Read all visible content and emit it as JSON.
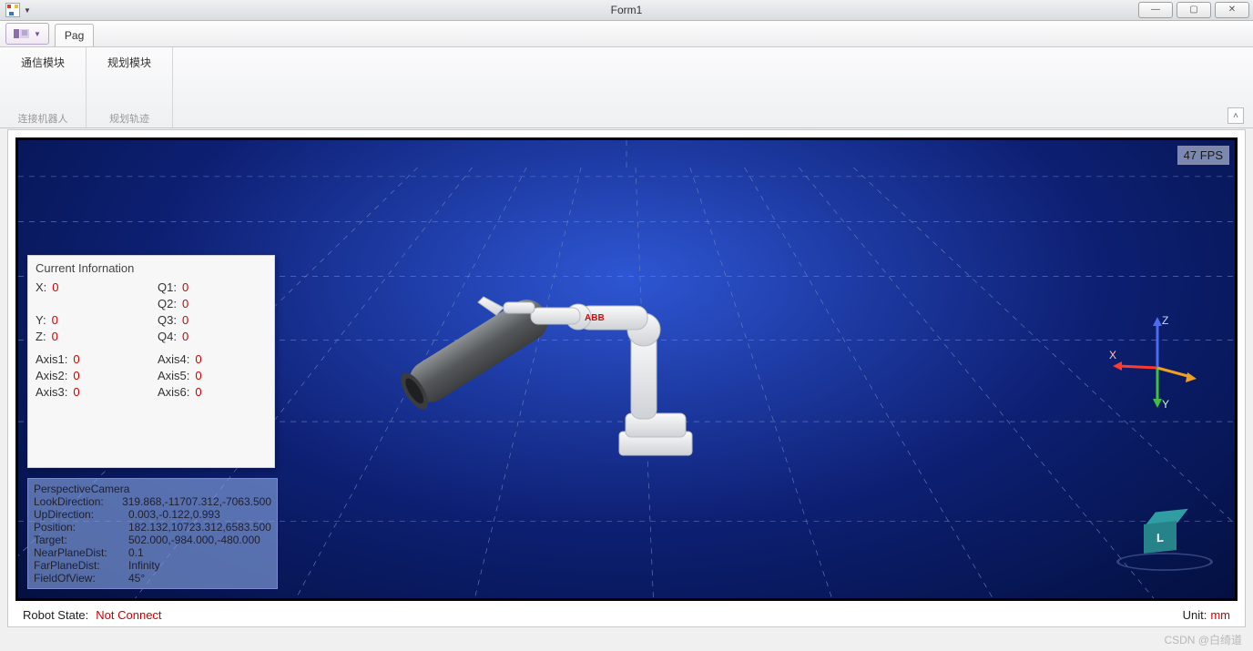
{
  "window": {
    "title": "Form1"
  },
  "ribbon": {
    "tab1": "Pag",
    "group1": {
      "button": "通信模块",
      "caption": "连接机器人"
    },
    "group2": {
      "button": "规划模块",
      "caption": "规划轨迹"
    }
  },
  "viewport": {
    "fps": "47 FPS",
    "axis_x": "X",
    "axis_y": "Y",
    "axis_z": "Z",
    "cube_face": "L"
  },
  "info": {
    "title": "Current Infornation",
    "X_label": "X:",
    "X": "0",
    "Y_label": "Y:",
    "Y": "0",
    "Z_label": "Z:",
    "Z": "0",
    "Q1_label": "Q1:",
    "Q1": "0",
    "Q2_label": "Q2:",
    "Q2": "0",
    "Q3_label": "Q3:",
    "Q3": "0",
    "Q4_label": "Q4:",
    "Q4": "0",
    "A1_label": "Axis1:",
    "A1": "0",
    "A2_label": "Axis2:",
    "A2": "0",
    "A3_label": "Axis3:",
    "A3": "0",
    "A4_label": "Axis4:",
    "A4": "0",
    "A5_label": "Axis5:",
    "A5": "0",
    "A6_label": "Axis6:",
    "A6": "0"
  },
  "camera": {
    "title": "PerspectiveCamera",
    "look_k": "LookDirection:",
    "look_v": "319.868,-11707.312,-7063.500",
    "up_k": "UpDirection:",
    "up_v": "0.003,-0.122,0.993",
    "pos_k": "Position:",
    "pos_v": "182.132,10723.312,6583.500",
    "tar_k": "Target:",
    "tar_v": "502.000,-984.000,-480.000",
    "near_k": "NearPlaneDist:",
    "near_v": "0.1",
    "far_k": "FarPlaneDist:",
    "far_v": "Infinity",
    "fov_k": "FieldOfView:",
    "fov_v": "45°"
  },
  "status": {
    "state_label": "Robot State:",
    "state_value": "Not Connect",
    "unit_label": "Unit:",
    "unit_value": "mm"
  },
  "watermark": "CSDN @白绮道"
}
